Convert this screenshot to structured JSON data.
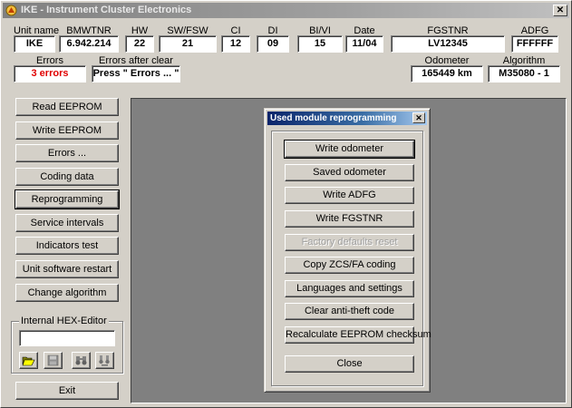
{
  "window": {
    "title": "IKE - Instrument Cluster Electronics",
    "close_glyph": "✕"
  },
  "header": {
    "labels": {
      "unit_name": "Unit name",
      "bmwtnr": "BMWTNR",
      "hw": "HW",
      "sw_fsw": "SW/FSW",
      "ci": "CI",
      "di": "DI",
      "bi_vi": "BI/VI",
      "date": "Date",
      "fgstnr": "FGSTNR",
      "adfg": "ADFG",
      "errors": "Errors",
      "errors_after_clear": "Errors after clear",
      "odometer": "Odometer",
      "algorithm": "Algorithm"
    },
    "values": {
      "unit_name": "IKE",
      "bmwtnr": "6.942.214",
      "hw": "22",
      "sw_fsw": "21",
      "ci": "12",
      "di": "09",
      "bi_vi": "15",
      "date": "11/04",
      "fgstnr": "LV12345",
      "adfg": "FFFFFF",
      "errors": "3 errors",
      "errors_after_clear": "Press \" Errors ... \"",
      "odometer": "165449 km",
      "algorithm": "M35080 - 1"
    },
    "errors_color": "#e00000"
  },
  "left_menu": {
    "read_eeprom": "Read EEPROM",
    "write_eeprom": "Write EEPROM",
    "errors": "Errors ...",
    "coding_data": "Coding data",
    "reprogramming": "Reprogramming",
    "service_intervals": "Service intervals",
    "indicators_test": "Indicators test",
    "unit_software_restart": "Unit software restart",
    "change_algorithm": "Change algorithm"
  },
  "hex_editor": {
    "legend": "Internal HEX-Editor",
    "input_value": "",
    "tools": [
      "open-folder-icon",
      "save-disk-icon",
      "find-binoculars-icon",
      "find-replace-icon"
    ]
  },
  "exit_label": "Exit",
  "dialog": {
    "title": "Used module reprogramming",
    "close_glyph": "✕",
    "buttons": {
      "write_odometer": "Write odometer",
      "saved_odometer": "Saved odometer",
      "write_adfg": "Write ADFG",
      "write_fgstnr": "Write FGSTNR",
      "factory_defaults_reset": "Factory defaults reset",
      "copy_zcs_fa": "Copy ZCS/FA coding",
      "languages_settings": "Languages and settings",
      "clear_anti_theft": "Clear anti-theft code",
      "recalc_checksum": "Recalculate EEPROM checksum",
      "close": "Close"
    }
  },
  "colors": {
    "window_face": "#d4d0c8",
    "work_area": "#808080",
    "active_title_start": "#0a246a",
    "inactive_title": "#808080"
  }
}
